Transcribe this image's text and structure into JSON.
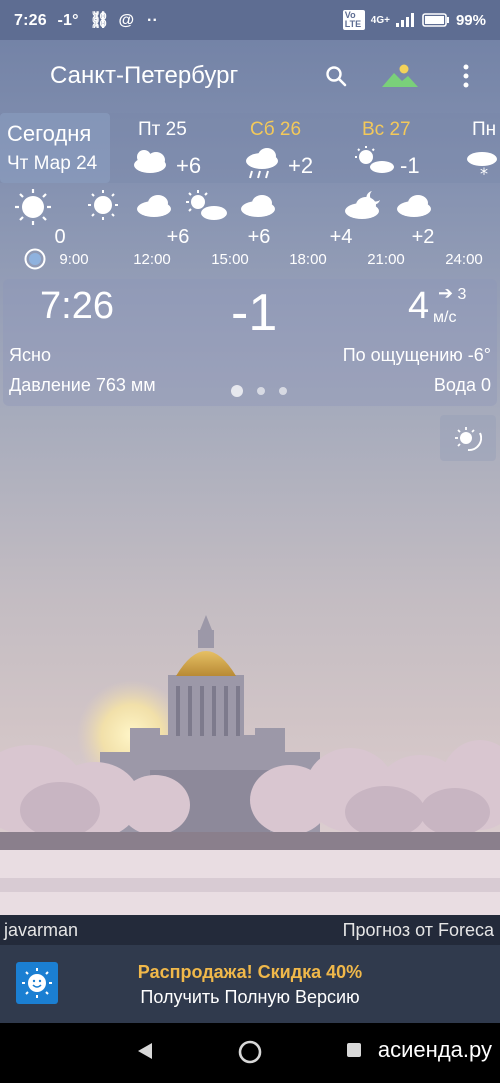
{
  "status_bar": {
    "time": "7:26",
    "temp": "-1°",
    "network": "4G+",
    "volte": "Vo LTE",
    "battery": "99%"
  },
  "app": {
    "city": "Санкт-Петербург"
  },
  "today": {
    "label": "Сегодня",
    "date": "Чт Мар 24"
  },
  "days": [
    {
      "label": "Пт 25",
      "temp": "+6",
      "icon": "partly-cloudy-icon",
      "color": "#ffffff"
    },
    {
      "label": "Сб 26",
      "temp": "+2",
      "icon": "rain-cloud-icon",
      "color": "#f3c95a"
    },
    {
      "label": "Вс 27",
      "temp": "-1",
      "icon": "sun-cloud-icon",
      "color": "#f3c95a"
    },
    {
      "label": "Пн",
      "temp": "",
      "icon": "snow-cloud-icon",
      "color": "#ffffff"
    }
  ],
  "hourly": [
    {
      "time": "9:00",
      "temp": "0",
      "icon": "sun-icon"
    },
    {
      "time": "12:00",
      "temp": "+6",
      "icon": "sun-icon"
    },
    {
      "time": "15:00",
      "temp": "+6",
      "icon": "cloud-icon"
    },
    {
      "time": "18:00",
      "temp": "+4",
      "icon": "sun-cloud-icon"
    },
    {
      "time": "21:00",
      "temp": "+2",
      "icon": "cloud-icon"
    },
    {
      "time": "24:00",
      "temp": "",
      "icon": "moon-cloud-icon"
    }
  ],
  "current": {
    "time": "7:26",
    "temp": "-1",
    "wind_speed": "4",
    "wind_dir_value": "3",
    "wind_unit": "м/с",
    "condition": "Ясно",
    "feels_like": "По ощущению -6°",
    "pressure": "Давление 763 мм",
    "water": "Вода 0"
  },
  "attribution": {
    "author": "javarman",
    "provider": "Прогноз от Foreca"
  },
  "promo": {
    "title": "Распродажа! Скидка 40%",
    "subtitle": "Получить Полную Версию"
  },
  "watermark": "асиенда.ру"
}
